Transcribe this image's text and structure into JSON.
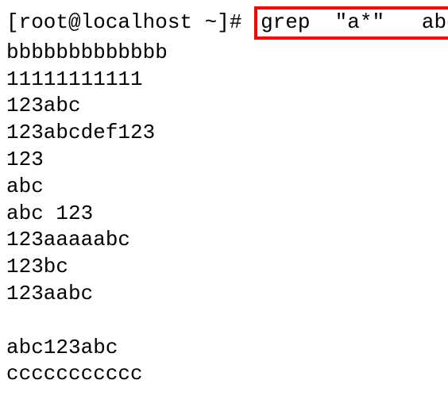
{
  "prompt": {
    "prefix": "[root@localhost ~]# ",
    "highlighted_command": "grep  \"a*\"   abc"
  },
  "output_lines": [
    "bbbbbbbbbbbbb",
    "11111111111",
    "123abc",
    "123abcdef123",
    "123",
    "abc",
    "abc 123",
    "123aaaaabc",
    "123bc",
    "123aabc",
    "",
    "abc123abc",
    "ccccccccccc"
  ]
}
